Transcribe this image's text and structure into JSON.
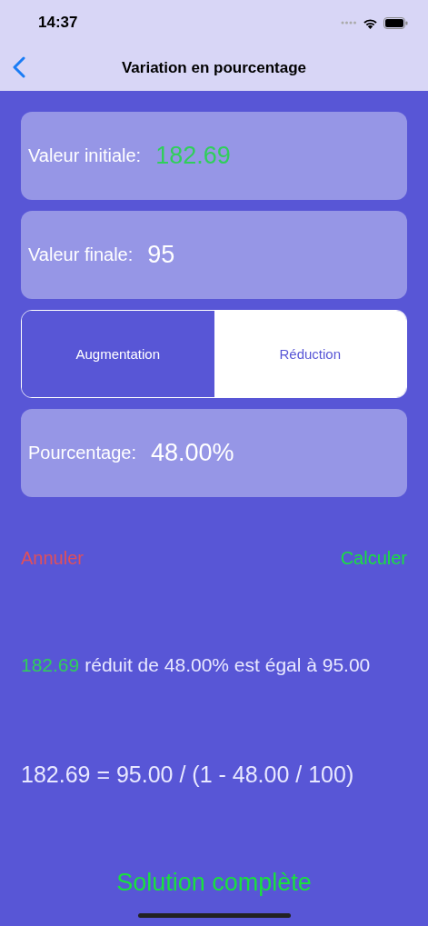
{
  "status_bar": {
    "time": "14:37"
  },
  "nav": {
    "title": "Variation en pourcentage"
  },
  "fields": [
    {
      "label": "Valeur initiale:",
      "value": "182.69",
      "color": "#2fcf5a"
    },
    {
      "label": "Valeur finale:",
      "value": "95",
      "color": "#ffffff"
    }
  ],
  "segments": [
    {
      "label": "Augmentation",
      "selected": false
    },
    {
      "label": "Réduction",
      "selected": true
    }
  ],
  "percentage": {
    "label": "Pourcentage:",
    "value": "48.00%"
  },
  "actions": {
    "cancel": "Annuler",
    "calculate": "Calculer"
  },
  "result": {
    "value": "182.69",
    "text": "réduit de 48.00% est égal à 95.00"
  },
  "formula": "182.69 = 95.00 / (1 - 48.00 / 100)",
  "solution_button": "Solution complète"
}
